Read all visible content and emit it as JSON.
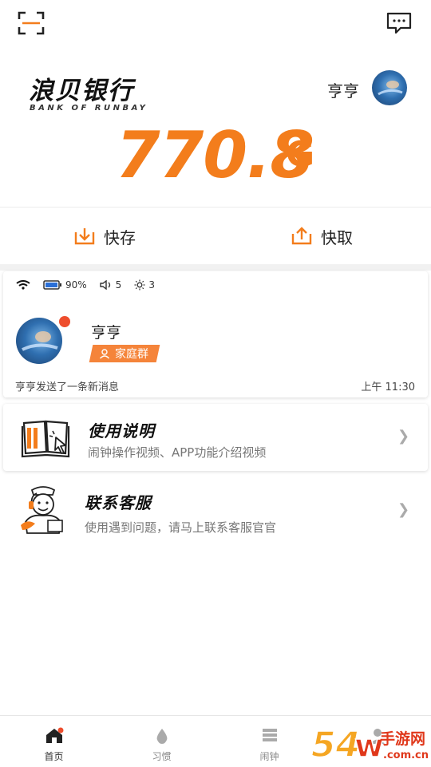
{
  "bank": {
    "name": "浪贝银行",
    "subtitle": "BANK OF RUNBAY",
    "user_name": "亨亨",
    "balance": "770.8",
    "currency_symbol": "G"
  },
  "actions": {
    "deposit_label": "快存",
    "withdraw_label": "快取"
  },
  "device_card": {
    "battery": "90%",
    "volume": "5",
    "brightness": "3",
    "name": "亨亨",
    "tag": "家庭群",
    "message": "亨亨发送了一条新消息",
    "time": "上午 11:30"
  },
  "list": {
    "manual": {
      "title": "使用说明",
      "desc": "闹钟操作视频、APP功能介绍视频"
    },
    "service": {
      "title": "联系客服",
      "desc": "使用遇到问题，请马上联系客服官官"
    }
  },
  "nav": {
    "items": [
      {
        "label": "首页"
      },
      {
        "label": "习惯"
      },
      {
        "label": "闹钟"
      },
      {
        "label": ""
      }
    ]
  },
  "watermark": {
    "text": "手游网",
    "domain": ".com.cn"
  },
  "colors": {
    "accent": "#f37d1c",
    "tag": "#f5843a",
    "badge": "#ee4d2d"
  }
}
